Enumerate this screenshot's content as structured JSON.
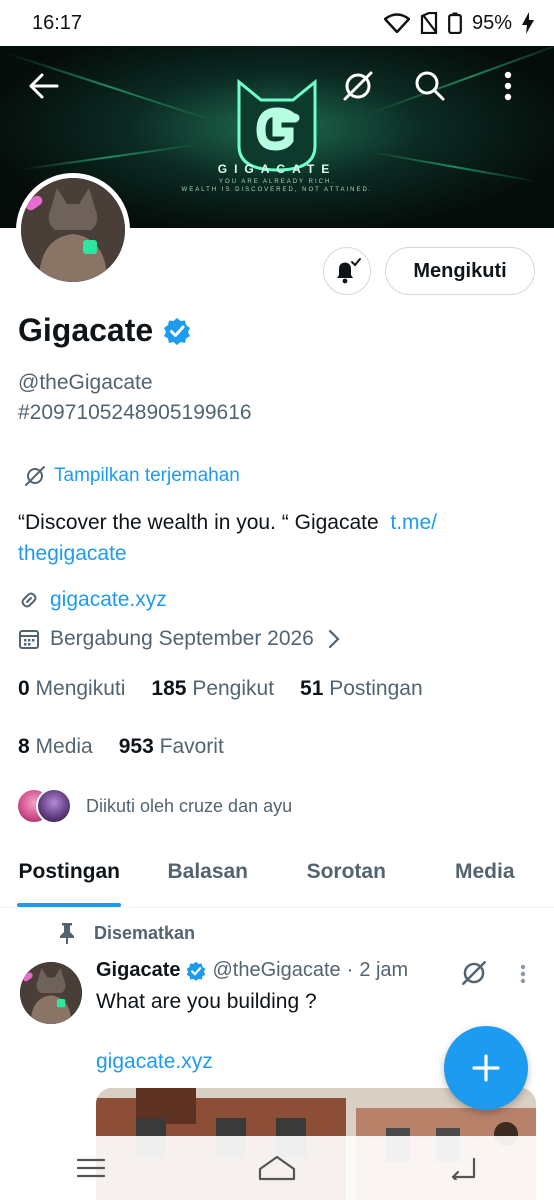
{
  "status_bar": {
    "time": "16:17",
    "battery": "95%"
  },
  "banner": {
    "brand": "GIGACATE",
    "tagline_1": "YOU ARE ALREADY RICH.",
    "tagline_2": "WEALTH IS DISCOVERED, NOT ATTAINED."
  },
  "profile": {
    "name": "Gigacate",
    "handle": "@theGigacate",
    "id": "#2097105248905199616",
    "translate_label": "Tampilkan terjemahan",
    "bio_text": "“Discover the wealth in you. “ Gigacate",
    "bio_link_1": "t.me/",
    "bio_link_2": "thegigacate",
    "website": "gigacate.xyz",
    "joined": "Bergabung September 2026",
    "follow_button": "Mengikuti"
  },
  "stats": {
    "following_count": "0",
    "following_label": "Mengikuti",
    "followers_count": "185",
    "followers_label": "Pengikut",
    "posts_count": "51",
    "posts_label": "Postingan",
    "media_count": "8",
    "media_label": "Media",
    "favorites_count": "953",
    "favorites_label": "Favorit"
  },
  "followed_by": "Diikuti oleh cruze dan ayu",
  "tabs": [
    {
      "label": "Postingan",
      "active": true
    },
    {
      "label": "Balasan",
      "active": false
    },
    {
      "label": "Sorotan",
      "active": false
    },
    {
      "label": "Media",
      "active": false
    }
  ],
  "post": {
    "pinned_label": "Disematkan",
    "author_name": "Gigacate",
    "author_handle": "@theGigacate",
    "separator": "·",
    "time": "2 jam",
    "text": "What are you building ?",
    "link": "gigacate.xyz"
  },
  "colors": {
    "accent": "#1d9bf0",
    "text": "#0f1419",
    "secondary": "#536471",
    "banner_glow": "#2ee6a2"
  },
  "icons": [
    "back-arrow-icon",
    "no-translate-icon",
    "search-icon",
    "more-vertical-icon",
    "bell-check-icon",
    "verified-badge-icon",
    "translate-icon",
    "link-icon",
    "calendar-icon",
    "chevron-right-icon",
    "pin-icon",
    "plus-icon",
    "menu-icon",
    "home-icon",
    "back-nav-icon"
  ]
}
